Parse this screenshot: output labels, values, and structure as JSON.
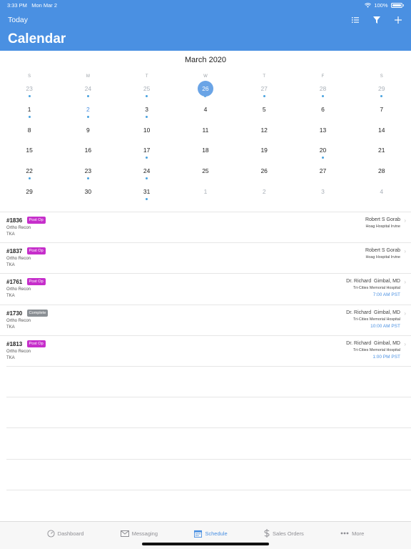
{
  "status_bar": {
    "time": "3:33 PM",
    "date": "Mon Mar 2",
    "battery": "100%"
  },
  "header": {
    "today_label": "Today",
    "title": "Calendar",
    "icons": [
      "list-icon",
      "filter-icon",
      "add-icon"
    ]
  },
  "calendar": {
    "month_title": "March 2020",
    "weekdays": [
      "S",
      "M",
      "T",
      "W",
      "T",
      "F",
      "S"
    ],
    "weeks": [
      [
        {
          "d": "23",
          "muted": true,
          "dot": true
        },
        {
          "d": "24",
          "muted": true,
          "dot": true
        },
        {
          "d": "25",
          "muted": true,
          "dot": true
        },
        {
          "d": "26",
          "selected": true,
          "dot": true
        },
        {
          "d": "27",
          "muted": true,
          "dot": true
        },
        {
          "d": "28",
          "muted": true,
          "dot": true
        },
        {
          "d": "29",
          "muted": true,
          "dot": true
        }
      ],
      [
        {
          "d": "1",
          "dot": true
        },
        {
          "d": "2",
          "blue": true,
          "dot": true
        },
        {
          "d": "3",
          "dot": true
        },
        {
          "d": "4"
        },
        {
          "d": "5"
        },
        {
          "d": "6"
        },
        {
          "d": "7"
        }
      ],
      [
        {
          "d": "8"
        },
        {
          "d": "9"
        },
        {
          "d": "10"
        },
        {
          "d": "11"
        },
        {
          "d": "12"
        },
        {
          "d": "13"
        },
        {
          "d": "14"
        }
      ],
      [
        {
          "d": "15"
        },
        {
          "d": "16"
        },
        {
          "d": "17",
          "dot": true
        },
        {
          "d": "18"
        },
        {
          "d": "19"
        },
        {
          "d": "20",
          "dot": true
        },
        {
          "d": "21"
        }
      ],
      [
        {
          "d": "22",
          "dot": true
        },
        {
          "d": "23",
          "dot": true
        },
        {
          "d": "24",
          "dot": true
        },
        {
          "d": "25"
        },
        {
          "d": "26"
        },
        {
          "d": "27"
        },
        {
          "d": "28"
        }
      ],
      [
        {
          "d": "29"
        },
        {
          "d": "30"
        },
        {
          "d": "31",
          "dot": true
        },
        {
          "d": "1",
          "muted": true
        },
        {
          "d": "2",
          "muted": true
        },
        {
          "d": "3",
          "muted": true
        },
        {
          "d": "4",
          "muted": true
        }
      ]
    ]
  },
  "cases": [
    {
      "id": "#1836",
      "status": "Post Op",
      "status_type": "postop",
      "specialty": "Ortho Recon",
      "procedure": "TKA",
      "surgeon": "Robert S Gorab",
      "hospital": "Hoag Hospital Irvine",
      "time": ""
    },
    {
      "id": "#1837",
      "status": "Post Op",
      "status_type": "postop",
      "specialty": "Ortho Recon",
      "procedure": "TKA",
      "surgeon": "Robert S Gorab",
      "hospital": "Hoag Hospital Irvine",
      "time": ""
    },
    {
      "id": "#1761",
      "status": "Post Op",
      "status_type": "postop",
      "specialty": "Ortho Recon",
      "procedure": "TKA",
      "surgeon": "Dr. Richard  Gimbal, MD",
      "hospital": "Tri-Cities Memorial Hospital",
      "time": "7:00 AM PST"
    },
    {
      "id": "#1730",
      "status": "Complete",
      "status_type": "complete",
      "specialty": "Ortho Recon",
      "procedure": "TKA",
      "surgeon": "Dr. Richard  Gimbal, MD",
      "hospital": "Tri-Cities Memorial Hospital",
      "time": "10:00 AM PST"
    },
    {
      "id": "#1813",
      "status": "Post Op",
      "status_type": "postop",
      "specialty": "Ortho Recon",
      "procedure": "TKA",
      "surgeon": "Dr. Richard  Gimbal, MD",
      "hospital": "Tri-Cities Memorial Hospital",
      "time": "1:00 PM PST"
    }
  ],
  "tabbar": {
    "tabs": [
      {
        "label": "Dashboard",
        "icon": "gauge-icon"
      },
      {
        "label": "Messaging",
        "icon": "envelope-icon"
      },
      {
        "label": "Schedule",
        "icon": "calendar-icon",
        "active": true
      },
      {
        "label": "Sales Orders",
        "icon": "dollar-icon"
      },
      {
        "label": "More",
        "icon": "more-dots-icon"
      }
    ]
  },
  "colors": {
    "header": "#4a90e2",
    "selected_day": "#6aa4e6",
    "post_op": "#c62fcb",
    "complete": "#8a8f94",
    "accent": "#4a90e2"
  }
}
